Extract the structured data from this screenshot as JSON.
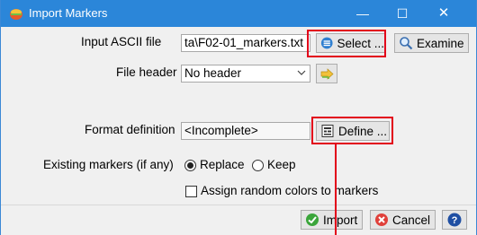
{
  "window": {
    "title": "Import Markers",
    "min_glyph": "—",
    "max_glyph": "☐",
    "close_glyph": "✕",
    "titlebar_color": "#2b86d9"
  },
  "input_file": {
    "label": "Input ASCII file",
    "value": "ta\\F02-01_markers.txt",
    "select_label": "Select ...",
    "examine_label": "Examine"
  },
  "file_header": {
    "label": "File header",
    "selected": "No header"
  },
  "format": {
    "label": "Format definition",
    "value": "<Incomplete>",
    "define_label": "Define ..."
  },
  "existing": {
    "label": "Existing markers (if any)",
    "options": [
      {
        "label": "Replace",
        "checked": true
      },
      {
        "label": "Keep",
        "checked": false
      }
    ]
  },
  "random_colors": {
    "label": "Assign random colors to markers",
    "checked": false
  },
  "actions": {
    "import_label": "Import",
    "cancel_label": "Cancel",
    "help_label": "?"
  },
  "colors": {
    "highlight": "#e2001a",
    "accent": "#2b86d9"
  }
}
